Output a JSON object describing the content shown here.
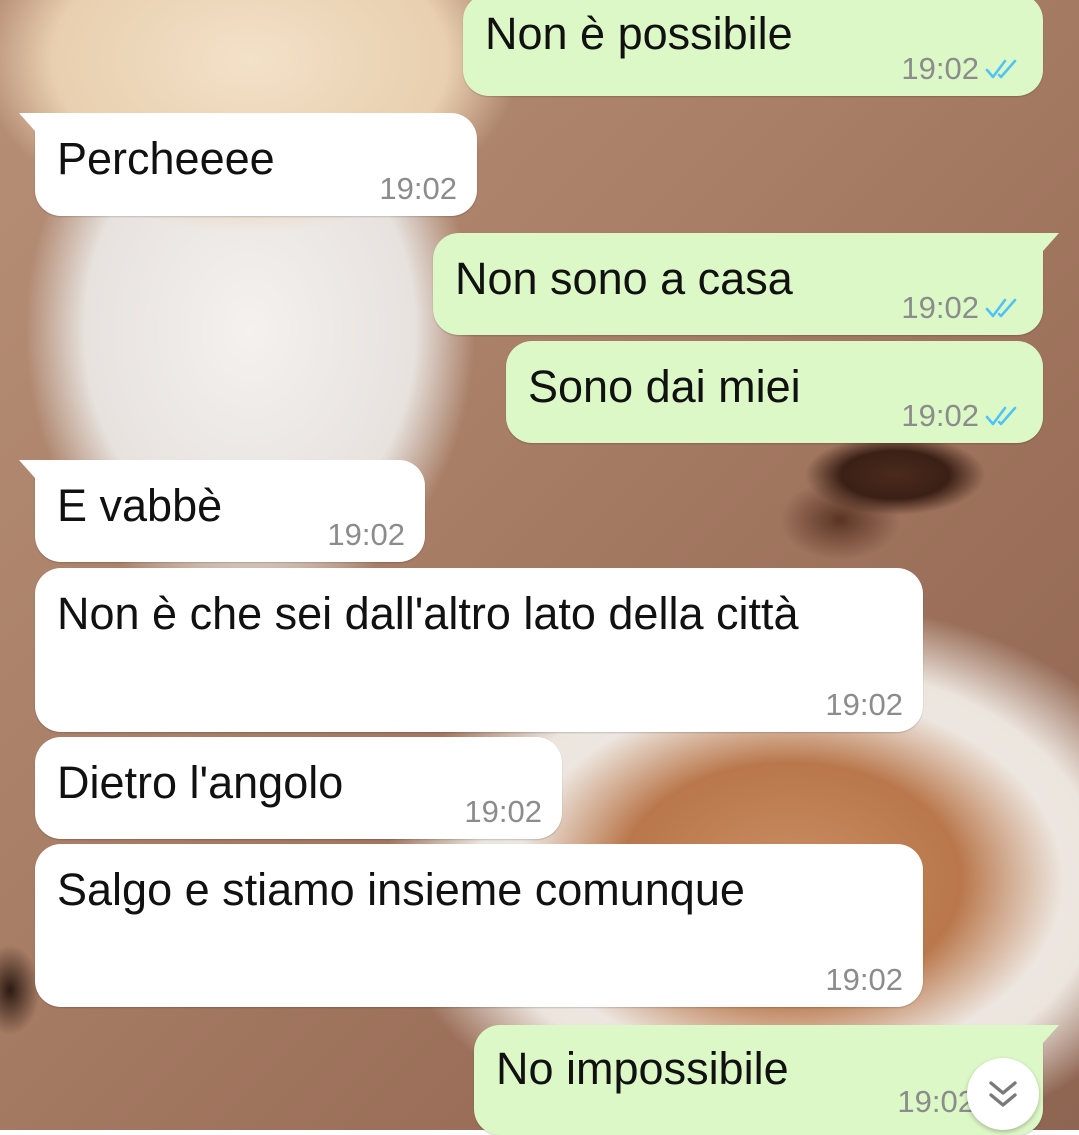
{
  "chat": {
    "messages": [
      {
        "direction": "outgoing",
        "text": "Non è possibile",
        "time": "19:02",
        "status": "read"
      },
      {
        "direction": "incoming",
        "text": "Percheeee",
        "time": "19:02"
      },
      {
        "direction": "outgoing",
        "text": "Non sono a casa",
        "time": "19:02",
        "status": "read"
      },
      {
        "direction": "outgoing",
        "text": "Sono dai miei",
        "time": "19:02",
        "status": "read"
      },
      {
        "direction": "incoming",
        "text": "E vabbè",
        "time": "19:02"
      },
      {
        "direction": "incoming",
        "text": "Non è che sei dall'altro lato della città",
        "time": "19:02"
      },
      {
        "direction": "incoming",
        "text": "Dietro l'angolo",
        "time": "19:02"
      },
      {
        "direction": "incoming",
        "text": "Salgo e stiamo insieme comunque",
        "time": "19:02"
      },
      {
        "direction": "outgoing",
        "text": "No impossibile",
        "time": "19:02",
        "status": "read"
      }
    ],
    "scroll_down_icon": "double-chevron-down-icon"
  },
  "colors": {
    "outgoing_bubble": "#dcf8c6",
    "incoming_bubble": "#ffffff",
    "read_ticks": "#4fc3f7",
    "timestamp": "#8c8c8c"
  }
}
